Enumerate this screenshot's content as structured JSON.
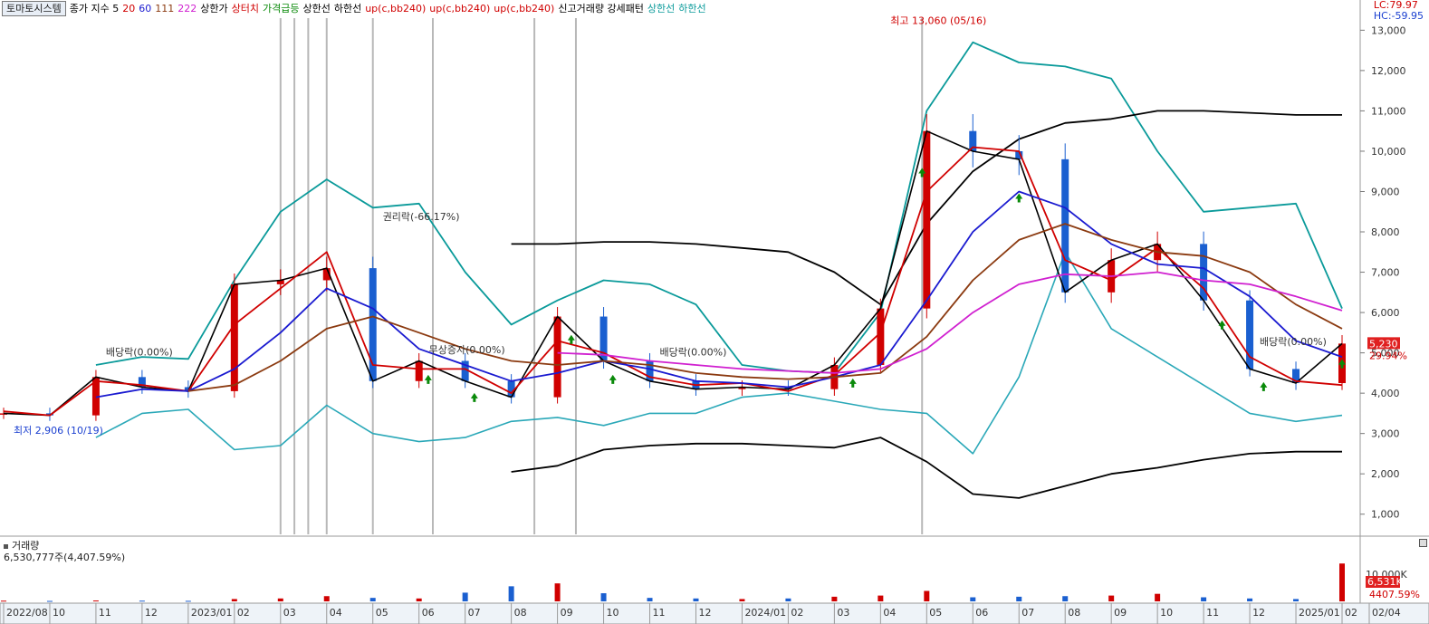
{
  "legend": {
    "stock_name": "토마토시스템",
    "items": [
      {
        "text": "종가 지수 5",
        "color": "#000000"
      },
      {
        "text": "20",
        "color": "#d00000"
      },
      {
        "text": "60",
        "color": "#1a1ad0"
      },
      {
        "text": "111",
        "color": "#8b3a10"
      },
      {
        "text": "222",
        "color": "#d020d0"
      },
      {
        "text": "상한가",
        "color": "#000000"
      },
      {
        "text": "상터치",
        "color": "#d00000"
      },
      {
        "text": "가격급등",
        "color": "#0a8a0a"
      },
      {
        "text": "상한선",
        "color": "#000000"
      },
      {
        "text": "하한선",
        "color": "#000000"
      },
      {
        "text": "up(c,bb240)",
        "color": "#d00000"
      },
      {
        "text": "up(c,bb240)",
        "color": "#d00000"
      },
      {
        "text": "up(c,bb240)",
        "color": "#d00000"
      },
      {
        "text": "신고거래량 강세패턴",
        "color": "#000000"
      },
      {
        "text": "상한선",
        "color": "#0a9a9a"
      },
      {
        "text": "하한선",
        "color": "#0a9a9a"
      }
    ]
  },
  "readout": {
    "lc": "LC:79.97",
    "hc": "HC:-59.95"
  },
  "volume_panel": {
    "title": "거래량",
    "value": "6,530,777주(4,407.59%)"
  },
  "colors": {
    "up": "#d00000",
    "down": "#1a5fd0",
    "ma5": "#000000",
    "ma20": "#d00000",
    "ma60": "#1a1ad0",
    "ma111": "#8b3a10",
    "ma222": "#d020d0",
    "bb_short": "#0a9a9a",
    "bb_long": "#000000",
    "arrow_up": "#0a8a0a"
  },
  "chart_data": {
    "type": "line",
    "title": "토마토시스템",
    "x": [
      "2022/08",
      "2022/10",
      "2022/11",
      "2022/12",
      "2023/01",
      "2023/02",
      "2023/03",
      "2023/04",
      "2023/05",
      "2023/06",
      "2023/07",
      "2023/08",
      "2023/09",
      "2023/10",
      "2023/11",
      "2023/12",
      "2024/01",
      "2024/02",
      "2024/03",
      "2024/04",
      "2024/05",
      "2024/06",
      "2024/07",
      "2024/08",
      "2024/09",
      "2024/10",
      "2024/11",
      "2024/12",
      "2025/01",
      "2025/02"
    ],
    "x_tick_labels": [
      "2022/08",
      "10",
      "11",
      "12",
      "2023/01",
      "02",
      "03",
      "04",
      "05",
      "06",
      "07",
      "08",
      "09",
      "10",
      "11",
      "12",
      "2024/01",
      "02",
      "03",
      "04",
      "05",
      "06",
      "07",
      "08",
      "09",
      "10",
      "11",
      "12",
      "2025/01",
      "02",
      "02/04"
    ],
    "y_ticks": [
      "1,000",
      "2,000",
      "3,000",
      "4,000",
      "5,000",
      "6,000",
      "7,000",
      "8,000",
      "9,000",
      "10,000",
      "11,000",
      "12,000",
      "13,000"
    ],
    "ylim": [
      500,
      13300
    ],
    "series": [
      {
        "name": "종가",
        "values": [
          3500,
          3450,
          4400,
          4150,
          4050,
          6700,
          6800,
          7100,
          4300,
          4800,
          4300,
          3900,
          5900,
          4800,
          4300,
          4100,
          4150,
          4100,
          4700,
          6100,
          10500,
          10000,
          9800,
          6500,
          7300,
          7700,
          6300,
          4600,
          4250,
          5230
        ]
      },
      {
        "name": "20",
        "values": [
          3550,
          3450,
          4300,
          4200,
          4050,
          5700,
          6600,
          7500,
          4700,
          4600,
          4600,
          4000,
          5300,
          5000,
          4400,
          4200,
          4250,
          4050,
          4450,
          5500,
          9000,
          10100,
          10000,
          7300,
          6800,
          7600,
          6600,
          4900,
          4300,
          4200
        ]
      },
      {
        "name": "60",
        "values": [
          null,
          null,
          3900,
          4100,
          4050,
          4600,
          5500,
          6600,
          6100,
          5100,
          4700,
          4300,
          4500,
          4800,
          4600,
          4300,
          4250,
          4150,
          4400,
          4700,
          6300,
          8000,
          9000,
          8600,
          7700,
          7200,
          7100,
          6400,
          5300,
          4900
        ]
      },
      {
        "name": "111",
        "values": [
          null,
          null,
          null,
          null,
          4050,
          4200,
          4800,
          5600,
          5900,
          5500,
          5100,
          4800,
          4700,
          4800,
          4700,
          4500,
          4400,
          4350,
          4400,
          4500,
          5400,
          6800,
          7800,
          8200,
          7800,
          7500,
          7400,
          7000,
          6200,
          5600
        ]
      },
      {
        "name": "222",
        "values": [
          null,
          null,
          null,
          null,
          null,
          null,
          null,
          null,
          null,
          null,
          null,
          null,
          5000,
          4950,
          4800,
          4700,
          4600,
          4550,
          4500,
          4600,
          5100,
          6000,
          6700,
          6950,
          6900,
          7000,
          6800,
          6700,
          6400,
          6050
        ]
      }
    ],
    "bollinger": {
      "short_upper": [
        null,
        null,
        4700,
        4900,
        4850,
        6800,
        8500,
        9300,
        8600,
        8700,
        7000,
        5700,
        6300,
        6800,
        6700,
        6200,
        4700,
        4550,
        4500,
        6000,
        11000,
        12700,
        12200,
        12100,
        11800,
        10000,
        8500,
        8600,
        8700,
        6100
      ],
      "short_lower": [
        null,
        null,
        2900,
        3500,
        3600,
        2600,
        2700,
        3700,
        3000,
        2800,
        2900,
        3300,
        3400,
        3200,
        3500,
        3500,
        3900,
        4000,
        3800,
        3600,
        3500,
        2500,
        4400,
        7500,
        5600,
        4900,
        4200,
        3500,
        3300,
        3450
      ],
      "long_upper": [
        null,
        null,
        null,
        null,
        null,
        null,
        null,
        null,
        null,
        null,
        null,
        7700,
        7700,
        7750,
        7750,
        7700,
        7600,
        7500,
        7000,
        6200,
        8200,
        9500,
        10300,
        10700,
        10800,
        11000,
        11000,
        10950,
        10900,
        10900
      ],
      "long_lower": [
        null,
        null,
        null,
        null,
        null,
        null,
        null,
        null,
        null,
        null,
        null,
        2050,
        2200,
        2600,
        2700,
        2750,
        2750,
        2700,
        2650,
        2900,
        2300,
        1500,
        1400,
        1700,
        2000,
        2150,
        2350,
        2500,
        2550,
        2550
      ]
    },
    "volume": {
      "unit": "주",
      "ticks": [
        "10,000K"
      ],
      "last_value_label": "6,531K",
      "last_ratio_label": "4407.59%",
      "values": [
        120,
        80,
        150,
        120,
        90,
        400,
        500,
        900,
        600,
        500,
        1500,
        2600,
        3100,
        1400,
        600,
        500,
        400,
        500,
        800,
        1000,
        1800,
        700,
        800,
        900,
        1000,
        1300,
        700,
        500,
        400,
        6531
      ]
    },
    "annotations": [
      {
        "text": "최고 13,060 (05/16)",
        "x": "2024/05",
        "y": 13060,
        "color": "#d00000"
      },
      {
        "text": "최저 2,906 (10/19)",
        "x": "2022/10",
        "y": 2906,
        "color": "#1a3fd0"
      },
      {
        "text": "권리락(-66.17%)",
        "x": "2023/06",
        "y": 8200,
        "color": "#333333"
      },
      {
        "text": "배당락(0.00%)",
        "x": "2022/12",
        "y": 4850,
        "color": "#333333"
      },
      {
        "text": "무상증자(0.00%)",
        "x": "2023/07",
        "y": 4900,
        "color": "#333333"
      },
      {
        "text": "배당락(0.00%)",
        "x": "2023/12",
        "y": 4850,
        "color": "#333333"
      },
      {
        "text": "배당락(0.00%)",
        "x": "2025/01",
        "y": 5100,
        "color": "#333333"
      }
    ],
    "last_price_label": "5,230",
    "last_change_label": "29.94%",
    "grid": true,
    "legend_position": "top-left"
  }
}
